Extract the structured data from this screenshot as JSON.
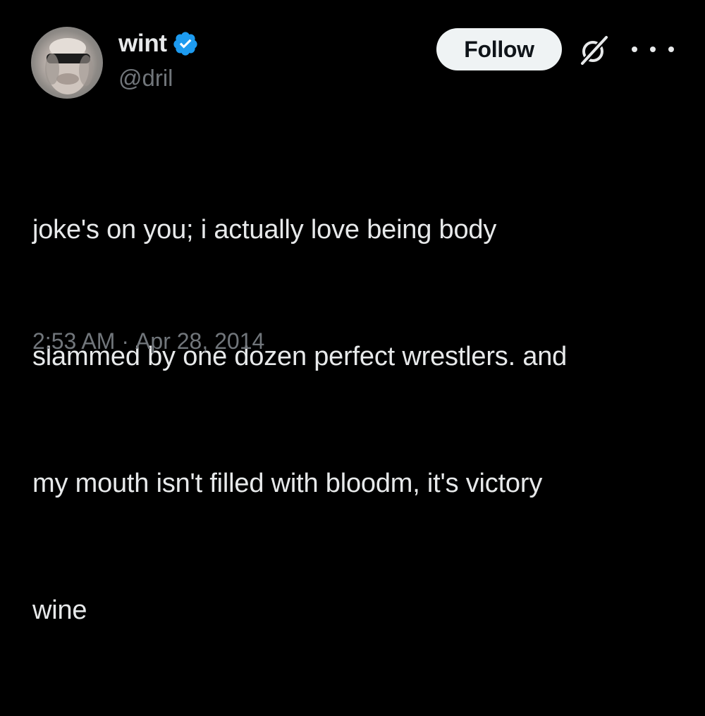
{
  "author": {
    "display_name": "wint",
    "handle": "@dril",
    "verified": true,
    "verified_color": "#1d9bf0"
  },
  "actions": {
    "follow_label": "Follow",
    "grok_icon": "grok-icon",
    "more_icon": "more-options-icon"
  },
  "tweet": {
    "lines": [
      "joke's on you; i actually love being body",
      "slammed by one dozen perfect wrestlers. and",
      "my mouth isn't filled with bloodm, it's victory",
      "wine"
    ]
  },
  "meta": {
    "time": "2:53 AM",
    "separator": "·",
    "date": "Apr 28, 2014"
  },
  "colors": {
    "background": "#000000",
    "text_primary": "#e7e9ea",
    "text_secondary": "#71767b",
    "button_bg": "#eff3f4",
    "button_text": "#0f1419"
  }
}
